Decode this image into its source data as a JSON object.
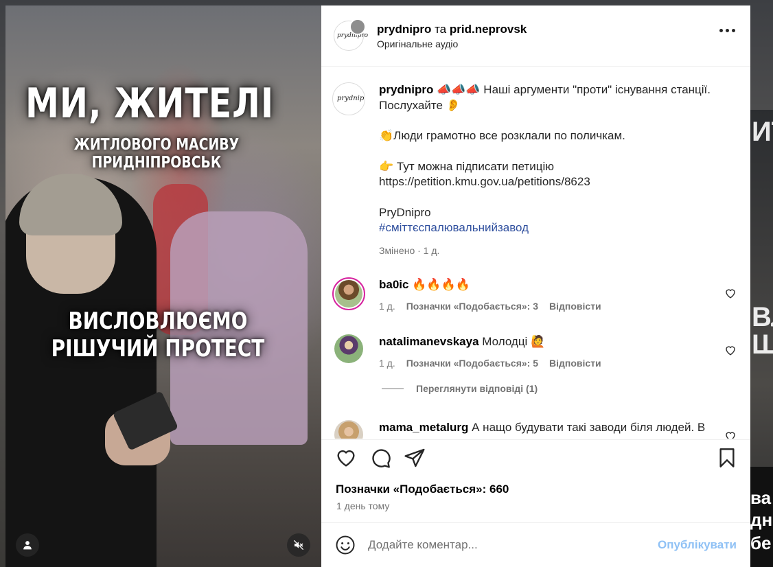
{
  "media": {
    "title_line1": "МИ, ЖИТЕЛІ",
    "title_line2": "ЖИТЛОВОГО МАСИВУ ПРИДНІПРОВСЬК",
    "title_line3": "ВИСЛОВЛЮЄМО",
    "title_line4": "РІШУЧИЙ ПРОТЕСТ",
    "icons": {
      "user": "user-icon",
      "mute": "muted-speaker-icon"
    }
  },
  "header": {
    "user1": "prydnipro",
    "conjunction": "та",
    "user2": "prid.neprovsk",
    "audio": "Оригінальне аудіо",
    "avatar_logo": "prydnipro"
  },
  "caption": {
    "user": "prydnipro",
    "line1": "📣📣📣 Наші аргументи \"проти\" існування станції. Послухайте 👂",
    "line2": "👏Люди грамотно все розклали по поличкам.",
    "line3": "👉 Тут можна підписати петицію",
    "url": "https://petition.kmu.gov.ua/petitions/8623",
    "signature": "PryDnipro",
    "hashtag": "#сміттєспалювальнийзавод",
    "meta": "Змінено · 1 д."
  },
  "comments": [
    {
      "user": "ba0ic",
      "text": "🔥🔥🔥🔥",
      "age": "1 д.",
      "likes": "Позначки «Подобається»: 3",
      "reply": "Відповісти"
    },
    {
      "user": "natalimanevskaya",
      "text": "Молодці 🙋",
      "age": "1 д.",
      "likes": "Позначки «Подобається»: 5",
      "reply": "Відповісти"
    },
    {
      "user": "mama_metalurg",
      "text": "А нащо будувати такі заводи біля людей. В"
    }
  ],
  "view_replies": "Переглянути відповіді (1)",
  "footer": {
    "likes": "Позначки «Подобається»: 660",
    "time": "1 день тому",
    "placeholder": "Додайте коментар...",
    "publish": "Опублікувати"
  },
  "backdrop": {
    "t1": "ИТ",
    "t2": "ВЛ",
    "t3": "Ш",
    "t4": "ва",
    "t5": "дні",
    "t6": "бе"
  }
}
